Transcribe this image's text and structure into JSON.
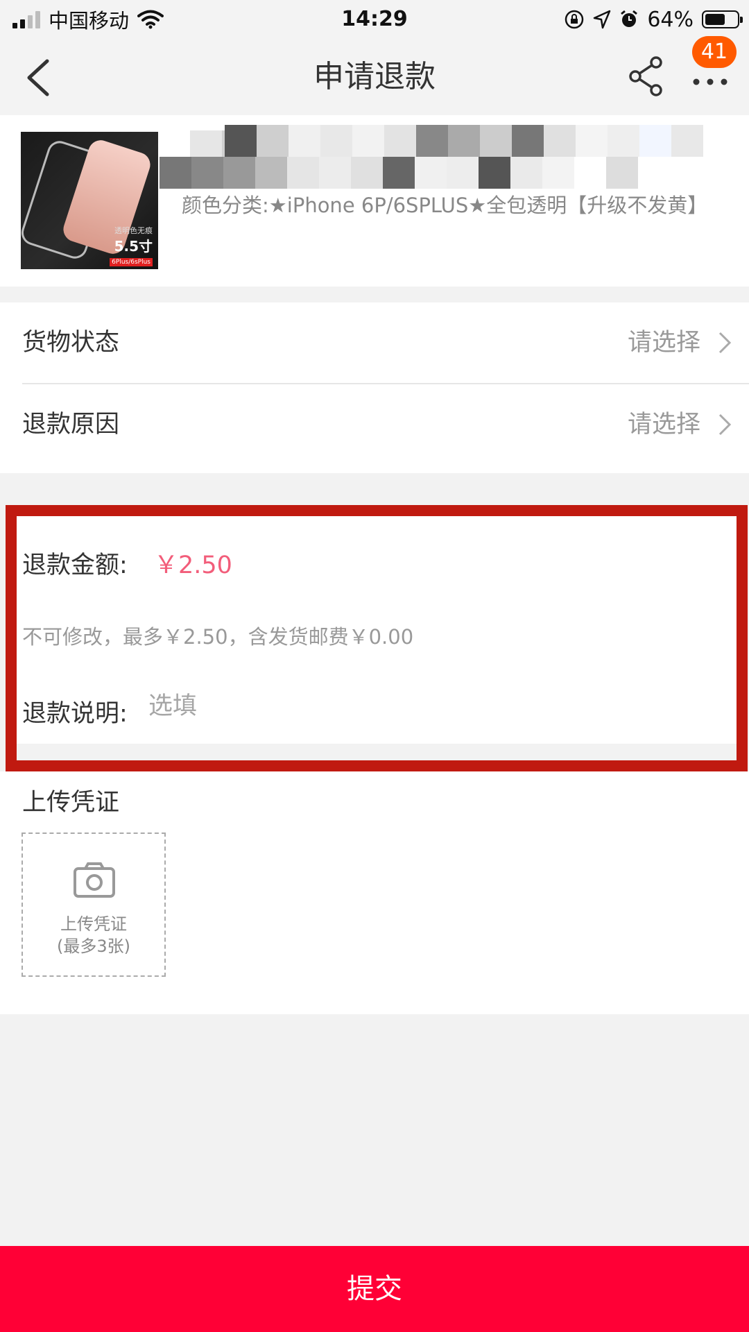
{
  "status_bar": {
    "carrier": "中国移动",
    "time": "14:29",
    "battery": "64%",
    "battery_level": 0.64
  },
  "nav": {
    "title": "申请退款",
    "badge_count": "41"
  },
  "product": {
    "variant": "颜色分类:★iPhone 6P/6SPLUS★全包透明【升级不发黄】",
    "thumb_caption_small": "透明色无痕",
    "thumb_caption_size": "5.5寸",
    "thumb_caption_tag": "6Plus/6sPlus"
  },
  "form": {
    "goods_status": {
      "label": "货物状态",
      "value": "请选择"
    },
    "refund_reason": {
      "label": "退款原因",
      "value": "请选择"
    },
    "amount_label": "退款金额:",
    "amount_value": "￥2.50",
    "amount_hint": "不可修改，最多￥2.50，含发货邮费￥0.00",
    "remark_label": "退款说明:",
    "remark_placeholder": "选填"
  },
  "upload": {
    "title": "上传凭证",
    "button_line1": "上传凭证",
    "button_line2": "(最多3张)"
  },
  "submit_label": "提交",
  "colors": {
    "accent": "#ff0036",
    "price": "#f25d7a",
    "highlight_border": "#c01a10",
    "badge": "#ff5a00"
  }
}
